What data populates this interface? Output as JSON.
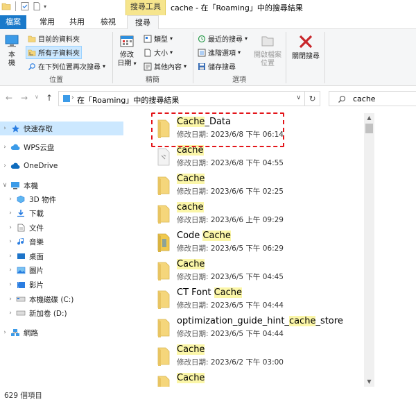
{
  "window": {
    "title": "cache - 在「Roaming」中的搜尋結果",
    "context_tab_header": "搜尋工具"
  },
  "tabs": [
    {
      "label": "檔案"
    },
    {
      "label": "常用"
    },
    {
      "label": "共用"
    },
    {
      "label": "檢視"
    },
    {
      "label": "搜尋"
    }
  ],
  "ribbon": {
    "location": {
      "computer_btn": "本\n機",
      "current_folder": "目前的資料夾",
      "all_subfolders": "所有子資料夾",
      "search_again": "在下列位置再次搜尋",
      "group_label": "位置"
    },
    "refine": {
      "date_modified": "修改\n日期",
      "kind": "類型",
      "size": "大小",
      "other_props": "其他內容",
      "group_label": "精簡"
    },
    "options": {
      "recent_searches": "最近的搜尋",
      "advanced_options": "進階選項",
      "save_search": "儲存搜尋",
      "open_location": "開啟檔案\n位置",
      "group_label": "選項"
    },
    "close": {
      "close_search": "關閉搜尋"
    }
  },
  "address": {
    "path": "在「Roaming」中的搜尋結果",
    "search_value": "cache"
  },
  "nav": {
    "items": [
      {
        "label": "快速存取"
      },
      {
        "label": "WPS云盘"
      },
      {
        "label": "OneDrive"
      },
      {
        "label": "本機"
      },
      {
        "label": "3D 物件"
      },
      {
        "label": "下載"
      },
      {
        "label": "文件"
      },
      {
        "label": "音樂"
      },
      {
        "label": "桌面"
      },
      {
        "label": "圖片"
      },
      {
        "label": "影片"
      },
      {
        "label": "本機磁碟 (C:)"
      },
      {
        "label": "新加卷 (D:)"
      },
      {
        "label": "網路"
      }
    ]
  },
  "files": {
    "date_prefix": "修改日期:",
    "items": [
      {
        "name_pre": "",
        "name_hl": "Cache",
        "name_post": "_Data",
        "date": "2023/6/8 下午 06:14"
      },
      {
        "name_pre": "",
        "name_hl": "cache",
        "name_post": "",
        "date": "2023/6/8 下午 04:55"
      },
      {
        "name_pre": "",
        "name_hl": "Cache",
        "name_post": "",
        "date": "2023/6/6 下午 02:25"
      },
      {
        "name_pre": "",
        "name_hl": "cache",
        "name_post": "",
        "date": "2023/6/6 上午 09:29"
      },
      {
        "name_pre": "Code ",
        "name_hl": "Cache",
        "name_post": "",
        "date": "2023/6/5 下午 06:29"
      },
      {
        "name_pre": "",
        "name_hl": "Cache",
        "name_post": "",
        "date": "2023/6/5 下午 04:45"
      },
      {
        "name_pre": "CT Font ",
        "name_hl": "Cache",
        "name_post": "",
        "date": "2023/6/5 下午 04:44"
      },
      {
        "name_pre": "optimization_guide_hint_",
        "name_hl": "cache",
        "name_post": "_store",
        "date": "2023/6/5 下午 04:44"
      },
      {
        "name_pre": "",
        "name_hl": "Cache",
        "name_post": "",
        "date": "2023/6/2 下午 03:00"
      },
      {
        "name_pre": "",
        "name_hl": "Cache",
        "name_post": "",
        "date": ""
      }
    ]
  },
  "status": {
    "count": "629 個項目"
  },
  "colors": {
    "accent": "#1979ca",
    "highlight": "#fbf6a8",
    "selection": "#cce8ff",
    "annotation": "#e3151a",
    "folder": "#f5d67b"
  }
}
